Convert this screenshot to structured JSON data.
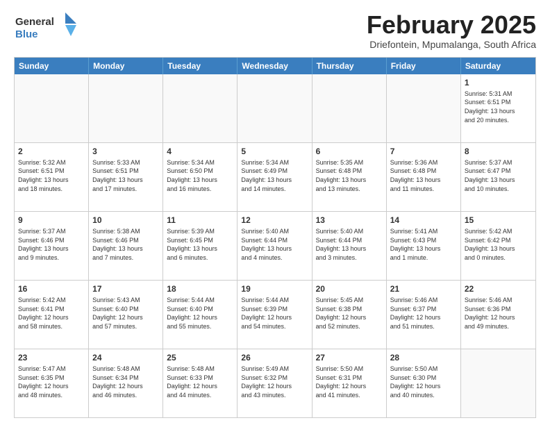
{
  "logo": {
    "line1": "General",
    "line2": "Blue",
    "icon_color": "#3a7ebf"
  },
  "header": {
    "month_title": "February 2025",
    "location": "Driefontein, Mpumalanga, South Africa"
  },
  "weekdays": [
    "Sunday",
    "Monday",
    "Tuesday",
    "Wednesday",
    "Thursday",
    "Friday",
    "Saturday"
  ],
  "rows": [
    [
      {
        "day": "",
        "info": ""
      },
      {
        "day": "",
        "info": ""
      },
      {
        "day": "",
        "info": ""
      },
      {
        "day": "",
        "info": ""
      },
      {
        "day": "",
        "info": ""
      },
      {
        "day": "",
        "info": ""
      },
      {
        "day": "1",
        "info": "Sunrise: 5:31 AM\nSunset: 6:51 PM\nDaylight: 13 hours\nand 20 minutes."
      }
    ],
    [
      {
        "day": "2",
        "info": "Sunrise: 5:32 AM\nSunset: 6:51 PM\nDaylight: 13 hours\nand 18 minutes."
      },
      {
        "day": "3",
        "info": "Sunrise: 5:33 AM\nSunset: 6:51 PM\nDaylight: 13 hours\nand 17 minutes."
      },
      {
        "day": "4",
        "info": "Sunrise: 5:34 AM\nSunset: 6:50 PM\nDaylight: 13 hours\nand 16 minutes."
      },
      {
        "day": "5",
        "info": "Sunrise: 5:34 AM\nSunset: 6:49 PM\nDaylight: 13 hours\nand 14 minutes."
      },
      {
        "day": "6",
        "info": "Sunrise: 5:35 AM\nSunset: 6:48 PM\nDaylight: 13 hours\nand 13 minutes."
      },
      {
        "day": "7",
        "info": "Sunrise: 5:36 AM\nSunset: 6:48 PM\nDaylight: 13 hours\nand 11 minutes."
      },
      {
        "day": "8",
        "info": "Sunrise: 5:37 AM\nSunset: 6:47 PM\nDaylight: 13 hours\nand 10 minutes."
      }
    ],
    [
      {
        "day": "9",
        "info": "Sunrise: 5:37 AM\nSunset: 6:46 PM\nDaylight: 13 hours\nand 9 minutes."
      },
      {
        "day": "10",
        "info": "Sunrise: 5:38 AM\nSunset: 6:46 PM\nDaylight: 13 hours\nand 7 minutes."
      },
      {
        "day": "11",
        "info": "Sunrise: 5:39 AM\nSunset: 6:45 PM\nDaylight: 13 hours\nand 6 minutes."
      },
      {
        "day": "12",
        "info": "Sunrise: 5:40 AM\nSunset: 6:44 PM\nDaylight: 13 hours\nand 4 minutes."
      },
      {
        "day": "13",
        "info": "Sunrise: 5:40 AM\nSunset: 6:44 PM\nDaylight: 13 hours\nand 3 minutes."
      },
      {
        "day": "14",
        "info": "Sunrise: 5:41 AM\nSunset: 6:43 PM\nDaylight: 13 hours\nand 1 minute."
      },
      {
        "day": "15",
        "info": "Sunrise: 5:42 AM\nSunset: 6:42 PM\nDaylight: 13 hours\nand 0 minutes."
      }
    ],
    [
      {
        "day": "16",
        "info": "Sunrise: 5:42 AM\nSunset: 6:41 PM\nDaylight: 12 hours\nand 58 minutes."
      },
      {
        "day": "17",
        "info": "Sunrise: 5:43 AM\nSunset: 6:40 PM\nDaylight: 12 hours\nand 57 minutes."
      },
      {
        "day": "18",
        "info": "Sunrise: 5:44 AM\nSunset: 6:40 PM\nDaylight: 12 hours\nand 55 minutes."
      },
      {
        "day": "19",
        "info": "Sunrise: 5:44 AM\nSunset: 6:39 PM\nDaylight: 12 hours\nand 54 minutes."
      },
      {
        "day": "20",
        "info": "Sunrise: 5:45 AM\nSunset: 6:38 PM\nDaylight: 12 hours\nand 52 minutes."
      },
      {
        "day": "21",
        "info": "Sunrise: 5:46 AM\nSunset: 6:37 PM\nDaylight: 12 hours\nand 51 minutes."
      },
      {
        "day": "22",
        "info": "Sunrise: 5:46 AM\nSunset: 6:36 PM\nDaylight: 12 hours\nand 49 minutes."
      }
    ],
    [
      {
        "day": "23",
        "info": "Sunrise: 5:47 AM\nSunset: 6:35 PM\nDaylight: 12 hours\nand 48 minutes."
      },
      {
        "day": "24",
        "info": "Sunrise: 5:48 AM\nSunset: 6:34 PM\nDaylight: 12 hours\nand 46 minutes."
      },
      {
        "day": "25",
        "info": "Sunrise: 5:48 AM\nSunset: 6:33 PM\nDaylight: 12 hours\nand 44 minutes."
      },
      {
        "day": "26",
        "info": "Sunrise: 5:49 AM\nSunset: 6:32 PM\nDaylight: 12 hours\nand 43 minutes."
      },
      {
        "day": "27",
        "info": "Sunrise: 5:50 AM\nSunset: 6:31 PM\nDaylight: 12 hours\nand 41 minutes."
      },
      {
        "day": "28",
        "info": "Sunrise: 5:50 AM\nSunset: 6:30 PM\nDaylight: 12 hours\nand 40 minutes."
      },
      {
        "day": "",
        "info": ""
      }
    ]
  ]
}
